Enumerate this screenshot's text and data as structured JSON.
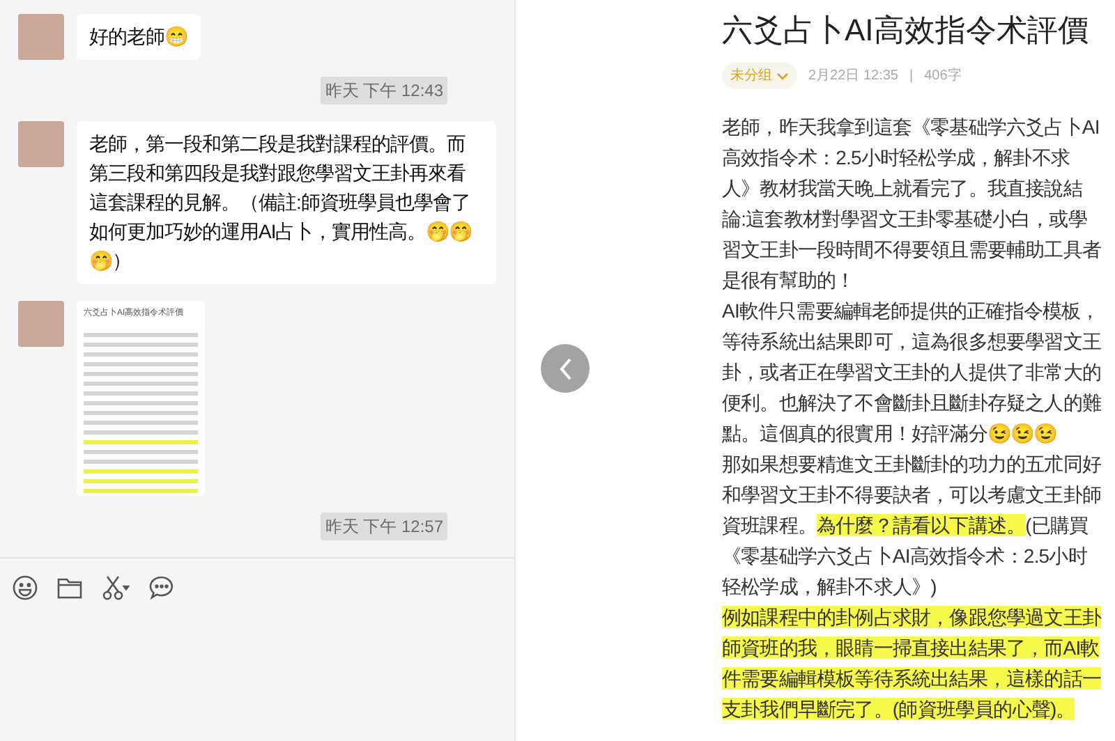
{
  "chat": {
    "messages": [
      {
        "kind": "text",
        "text": "好的老師😁"
      },
      {
        "kind": "time",
        "text": "昨天 下午 12:43"
      },
      {
        "kind": "text",
        "text": "老師，第一段和第二段是我對課程的評價。而第三段和第四段是我對跟您學習文王卦再來看這套課程的見解。（備註:師資班學員也學會了如何更加巧妙的運用AI占卜，實用性高。🤭🤭🤭）"
      },
      {
        "kind": "image",
        "text": "六爻占卜AI高效指令术評價"
      },
      {
        "kind": "time",
        "text": "昨天 下午 12:57"
      }
    ]
  },
  "article": {
    "title": "六爻占卜AI高效指令术評價",
    "group": "未分组",
    "date": "2月22日 12:35",
    "separator": "|",
    "word_count": "406字",
    "paragraphs": [
      [
        {
          "text": "老師，昨天我拿到這套《零基础学六爻占卜AI高效指令术：2.5小时轻松学成，解卦不求人》教材我當天晚上就看完了。我直接說結論:這套教材對學習文王卦零基礎小白，或學習文王卦一段時間不得要領且需要輔助工具者是很有幫助的！",
          "highlighted": false
        }
      ],
      [
        {
          "text": "AI軟件只需要編輯老師提供的正確指令模板，等待系統出結果即可，這為很多想要學習文王卦，或者正在學習文王卦的人提供了非常大的便利。也解決了不會斷卦且斷卦存疑之人的難點。這個真的很實用！好評滿分😉😉😉",
          "highlighted": false
        }
      ],
      [
        {
          "text": "那如果想要精進文王卦斷卦的功力的五朮同好和學習文王卦不得要訣者，可以考慮文王卦師資班課程。",
          "highlighted": false
        },
        {
          "text": "為什麼？請看以下講述。",
          "highlighted": true
        },
        {
          "text": "(已購買《零基础学六爻占卜AI高效指令术：2.5小时轻松学成，解卦不求人》)",
          "highlighted": false
        }
      ],
      [
        {
          "text": "例如課程中的卦例占求財，像跟您學過文王卦師資班的我，眼睛一掃直接出結果了，而AI軟件需要編輯模板等待系統出結果，這樣的話一支卦我們早斷完了。(師資班學員的心聲)。",
          "highlighted": true
        }
      ]
    ]
  }
}
